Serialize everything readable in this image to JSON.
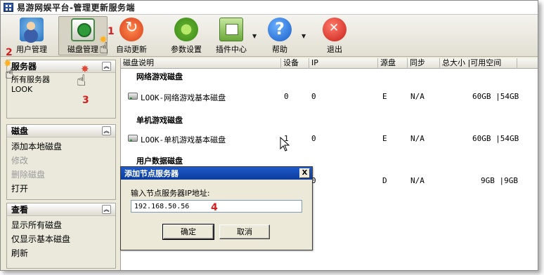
{
  "window": {
    "title": "易游网娱平台-管理更新服务端"
  },
  "toolbar": {
    "buttons": [
      {
        "label": "用户管理",
        "icon": "users-icon"
      },
      {
        "label": "磁盘管理",
        "icon": "disk-manage-icon"
      },
      {
        "label": "自动更新",
        "icon": "auto-update-icon"
      },
      {
        "label": "参数设置",
        "icon": "settings-gear-icon"
      },
      {
        "label": "插件中心",
        "icon": "plugin-icon"
      },
      {
        "label": "帮助",
        "icon": "help-icon"
      },
      {
        "label": "退出",
        "icon": "exit-icon"
      }
    ],
    "dropdown_caret": "▼"
  },
  "sidebar": {
    "servers": {
      "title": "服务器",
      "toggle": "︽",
      "items": [
        "所有服务器",
        "LOOK"
      ]
    },
    "disks": {
      "title": "磁盘",
      "toggle": "︽",
      "items": [
        "添加本地磁盘",
        "修改",
        "删除磁盘",
        "打开"
      ],
      "disabled": [
        false,
        true,
        true,
        false
      ]
    },
    "view": {
      "title": "查看",
      "toggle": "︽",
      "items": [
        "显示所有磁盘",
        "仅显示基本磁盘",
        "刷新"
      ]
    }
  },
  "table": {
    "columns": [
      "磁盘说明",
      "设备",
      "IP",
      "源盘",
      "同步",
      "总大小 |可用空间"
    ],
    "groups": [
      {
        "title": "网络游戏磁盘",
        "row": {
          "name": "LOOK-网络游戏基本磁盘",
          "device": "0",
          "ip": "0",
          "source": "E",
          "sync": "N/A",
          "size": "60GB |54GB"
        }
      },
      {
        "title": "单机游戏磁盘",
        "row": {
          "name": "LOOK-单机游戏基本磁盘",
          "device": "1",
          "ip": "0",
          "source": "E",
          "sync": "N/A",
          "size": "60GB |54GB"
        }
      },
      {
        "title": "用户数据磁盘",
        "row": {
          "name": "",
          "device": "",
          "ip": "0",
          "source": "D",
          "sync": "N/A",
          "size": "9GB |9GB"
        }
      }
    ]
  },
  "dialog": {
    "title": "添加节点服务器",
    "close": "X",
    "label": "输入节点服务器IP地址:",
    "ip_value": "192.168.50.56",
    "ok_label": "确定",
    "cancel_label": "取消"
  },
  "annotations": {
    "m1": "1",
    "m2": "2",
    "m3": "3",
    "m4": "4"
  },
  "colors": {
    "title_bar_dialog": "#0c3c9c",
    "annotation_red": "#d42020"
  }
}
